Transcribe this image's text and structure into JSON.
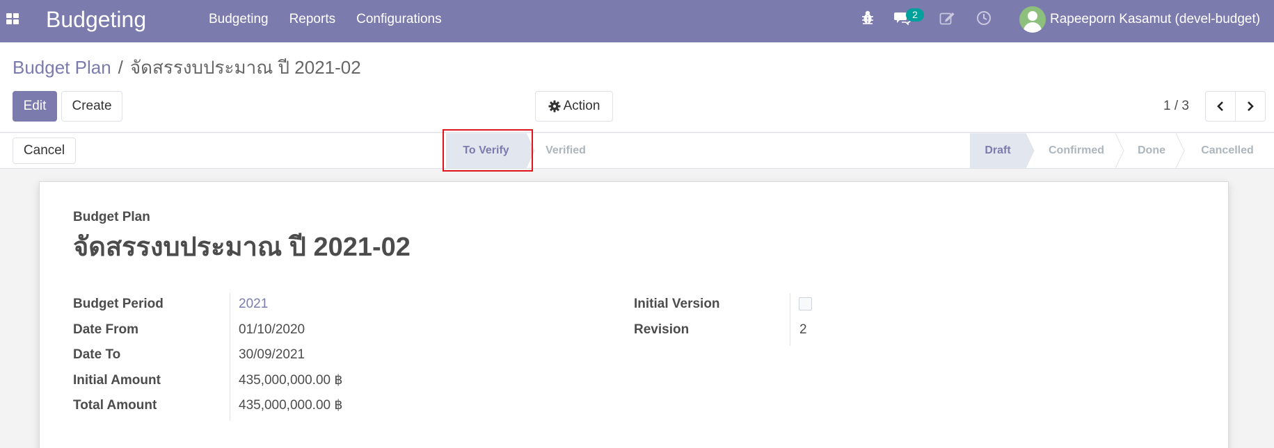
{
  "navbar": {
    "brand": "Budgeting",
    "menu": [
      "Budgeting",
      "Reports",
      "Configurations"
    ],
    "messages_count": "2",
    "user_name": "Rapeeporn Kasamut (devel-budget)",
    "icons": [
      "apps-icon",
      "bug-icon",
      "chat-icon",
      "edit-icon",
      "clock-icon"
    ]
  },
  "breadcrumb": {
    "parent": "Budget Plan",
    "separator": "/",
    "current": "จัดสรรงบประมาณ ปี 2021-02"
  },
  "buttons": {
    "edit": "Edit",
    "create": "Create",
    "action": "Action",
    "cancel": "Cancel"
  },
  "pager": {
    "text": "1 / 3"
  },
  "statusbar": {
    "verify_steps": [
      "To Verify",
      "Verified"
    ],
    "states": [
      "Draft",
      "Confirmed",
      "Done",
      "Cancelled"
    ]
  },
  "form": {
    "label": "Budget Plan",
    "title": "จัดสรรงบประมาณ ปี 2021-02",
    "left_fields": [
      {
        "label": "Budget Period",
        "value": "2021"
      },
      {
        "label": "Date From",
        "value": "01/10/2020"
      },
      {
        "label": "Date To",
        "value": "30/09/2021"
      },
      {
        "label": "Initial Amount",
        "value": "435,000,000.00 ฿"
      },
      {
        "label": "Total Amount",
        "value": "435,000,000.00 ฿"
      }
    ],
    "right_fields": [
      {
        "label": "Initial Version",
        "value": ""
      },
      {
        "label": "Revision",
        "value": "2"
      }
    ]
  },
  "colors": {
    "brand": "#7c7bad",
    "badge": "#00a09d",
    "highlight": "#e0151c"
  }
}
